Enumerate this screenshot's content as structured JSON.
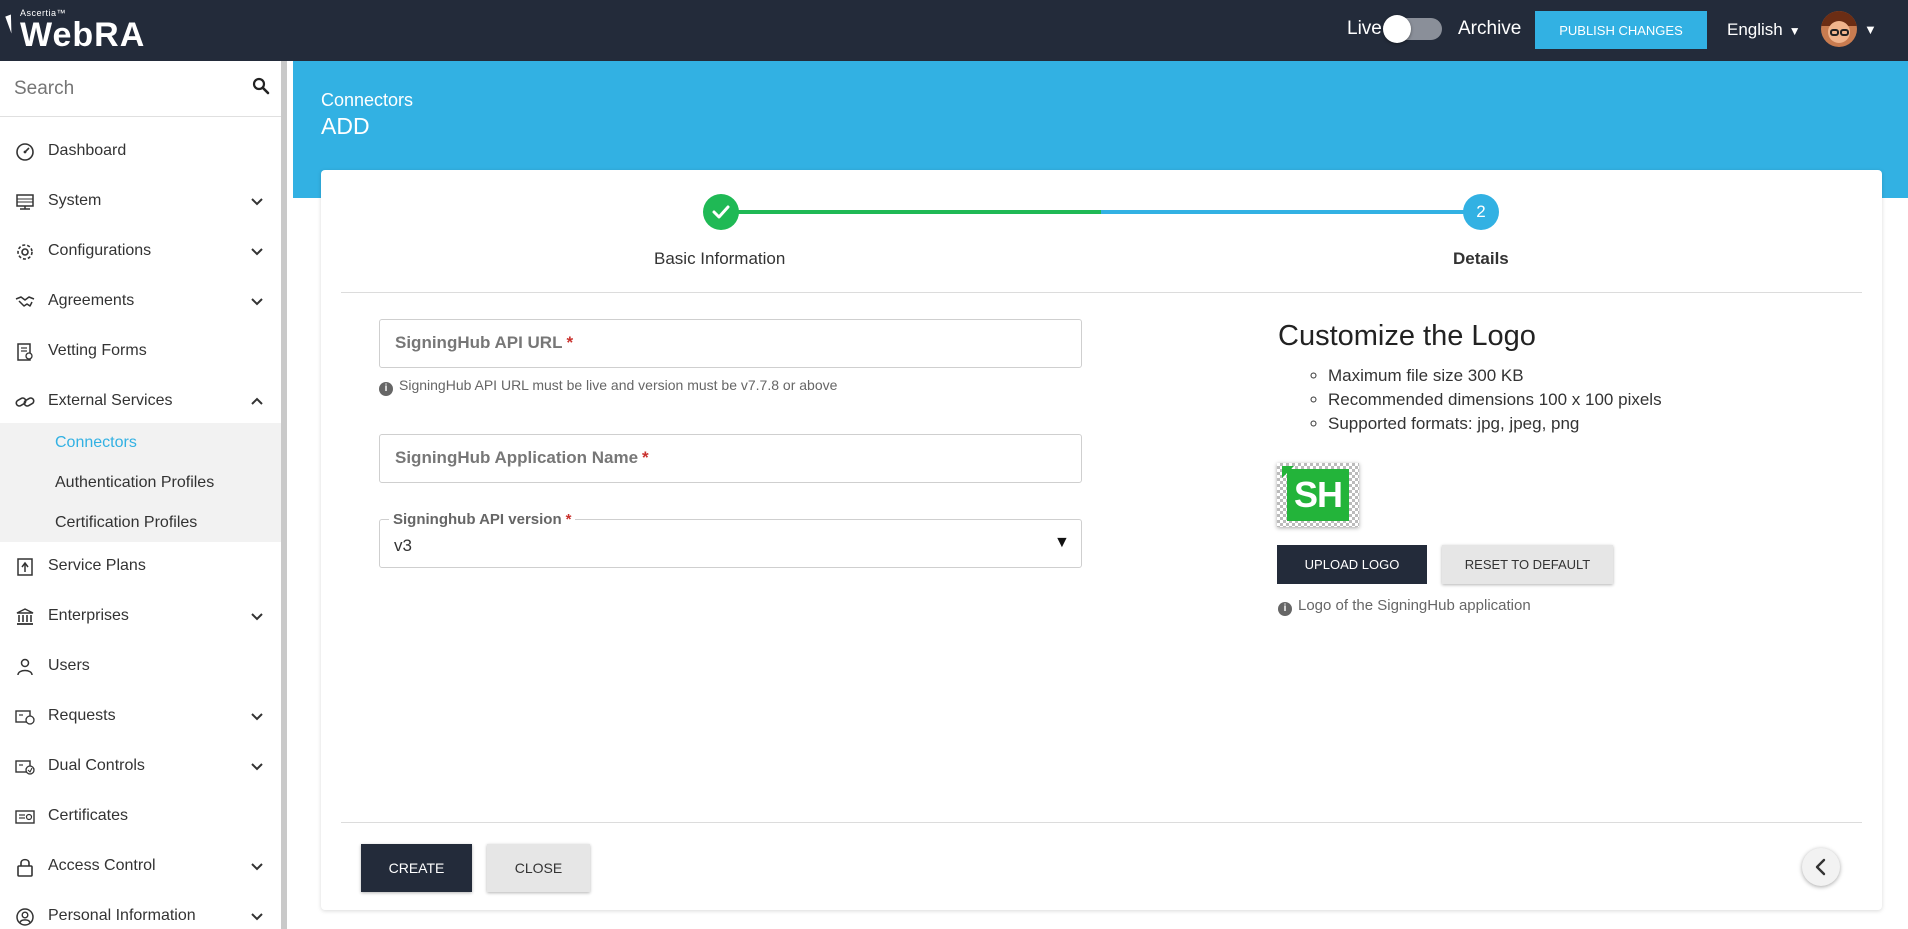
{
  "app": {
    "brand_tm": "Ascertia™",
    "brand_name": "WebRA"
  },
  "topbar": {
    "live_label": "Live",
    "archive_label": "Archive",
    "publish_label": "PUBLISH CHANGES",
    "language": "English"
  },
  "sidebar": {
    "search_placeholder": "Search",
    "items": [
      {
        "label": "Dashboard",
        "icon": "speedometer-icon"
      },
      {
        "label": "System",
        "icon": "server-icon"
      },
      {
        "label": "Configurations",
        "icon": "gear-icon"
      },
      {
        "label": "Agreements",
        "icon": "handshake-icon"
      },
      {
        "label": "Vetting Forms",
        "icon": "form-icon"
      },
      {
        "label": "External Services",
        "icon": "link-icon"
      },
      {
        "label": "Service Plans",
        "icon": "plan-icon"
      },
      {
        "label": "Enterprises",
        "icon": "bank-icon"
      },
      {
        "label": "Users",
        "icon": "user-icon"
      },
      {
        "label": "Requests",
        "icon": "requests-icon"
      },
      {
        "label": "Dual Controls",
        "icon": "dual-control-icon"
      },
      {
        "label": "Certificates",
        "icon": "certificate-icon"
      },
      {
        "label": "Access Control",
        "icon": "lock-icon"
      },
      {
        "label": "Personal Information",
        "icon": "profile-icon"
      }
    ],
    "sub_items": [
      {
        "label": "Connectors"
      },
      {
        "label": "Authentication Profiles"
      },
      {
        "label": "Certification Profiles"
      }
    ]
  },
  "header": {
    "breadcrumb": "Connectors",
    "title": "ADD"
  },
  "stepper": {
    "step1_label": "Basic Information",
    "step2_number": "2",
    "step2_label": "Details"
  },
  "form": {
    "api_url_label": "SigningHub API URL",
    "api_url_hint": "SigningHub API URL must be live and version must be v7.7.8 or above",
    "app_name_label": "SigningHub Application Name",
    "api_version_label": "Signinghub API version",
    "api_version_value": "v3",
    "required_mark": "*"
  },
  "logo_panel": {
    "title": "Customize the Logo",
    "rules": [
      "Maximum file size 300 KB",
      "Recommended dimensions 100 x 100 pixels",
      "Supported formats: jpg, jpeg, png"
    ],
    "logo_text": "SH",
    "upload_label": "UPLOAD LOGO",
    "reset_label": "RESET TO DEFAULT",
    "hint": "Logo of the SigningHub application"
  },
  "footer": {
    "create_label": "CREATE",
    "close_label": "CLOSE"
  },
  "colors": {
    "topbar": "#232b3a",
    "accent": "#32b1e3",
    "success": "#1fb955"
  }
}
